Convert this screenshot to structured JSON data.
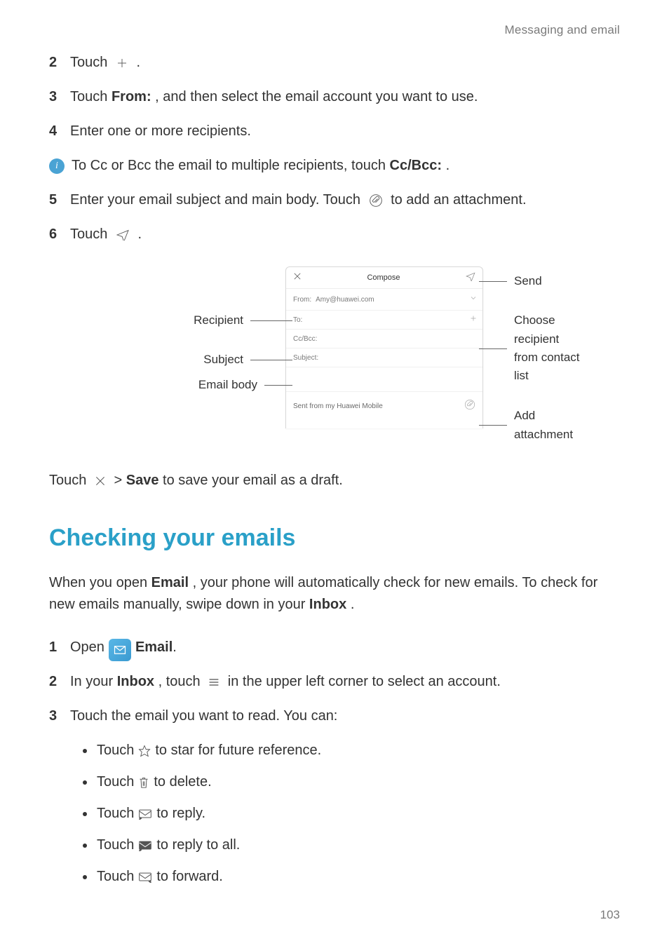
{
  "header": {
    "section": "Messaging and email"
  },
  "steps_top": [
    {
      "num": "2",
      "prefix": "Touch ",
      "after": " ."
    },
    {
      "num": "3",
      "prefix": "Touch ",
      "bold": "From:",
      "after": ", and then select the email account you want to use."
    },
    {
      "num": "4",
      "text": "Enter one or more recipients."
    }
  ],
  "info": {
    "prefix": "To Cc or Bcc the email to multiple recipients, touch ",
    "bold": "Cc/Bcc:",
    "after": "."
  },
  "step5": {
    "num": "5",
    "before": "Enter your email subject and main body. Touch ",
    "after": " to add an attachment."
  },
  "step6": {
    "num": "6",
    "prefix": "Touch ",
    "after": " ."
  },
  "compose": {
    "title": "Compose",
    "from_label": "From:",
    "from_value": "Amy@huawei.com",
    "to_label": "To:",
    "ccbcc_label": "Cc/Bcc:",
    "subject_label": "Subject:",
    "signature": "Sent from my Huawei Mobile"
  },
  "callouts": {
    "recipient": "Recipient",
    "subject": "Subject",
    "body": "Email body",
    "send": "Send",
    "contacts": "Choose recipient from contact list",
    "attachment": "Add attachment"
  },
  "draft_line": {
    "prefix": "Touch ",
    "mid": " > ",
    "bold": "Save",
    "after": " to save your email as a draft."
  },
  "section_title": "Checking your emails",
  "section_para": {
    "p1a": "When you open ",
    "bold1": "Email",
    "p1b": ", your phone will automatically check for new emails. To check for new emails manually, swipe down in your ",
    "bold2": "Inbox",
    "p1c": "."
  },
  "steps_bottom": {
    "s1": {
      "num": "1",
      "prefix": "Open ",
      "bold": "Email",
      "after": "."
    },
    "s2": {
      "num": "2",
      "before": "In your ",
      "bold": "Inbox",
      "mid": ", touch ",
      "after": " in the upper left corner to select an account."
    },
    "s3": {
      "num": "3",
      "text": "Touch the email you want to read. You can:"
    }
  },
  "bullets": {
    "b1_before": "Touch ",
    "b1_after": " to star for future reference.",
    "b2_before": "Touch ",
    "b2_after": " to delete.",
    "b3_before": "Touch ",
    "b3_after": "to reply.",
    "b4_before": "Touch ",
    "b4_after": "to reply to all.",
    "b5_before": "Touch ",
    "b5_after": "to forward."
  },
  "page_number": "103"
}
